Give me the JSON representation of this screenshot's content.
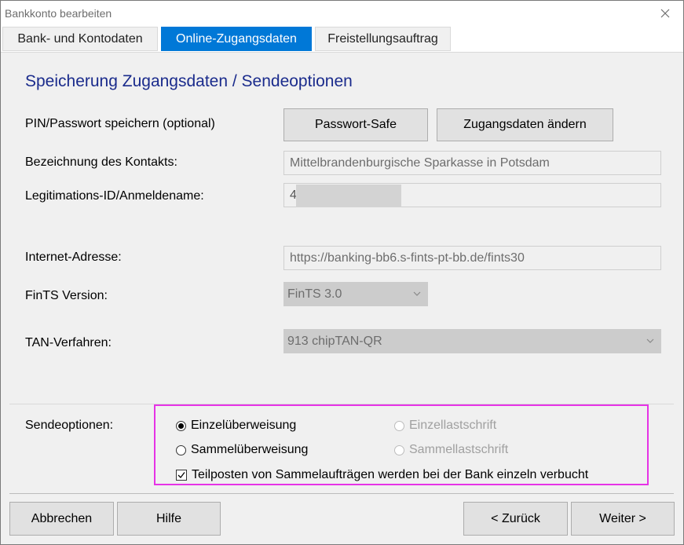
{
  "window": {
    "title": "Bankkonto bearbeiten"
  },
  "tabs": [
    {
      "label": "Bank- und Kontodaten"
    },
    {
      "label": "Online-Zugangsdaten"
    },
    {
      "label": "Freistellungsauftrag"
    }
  ],
  "section": {
    "heading": "Speicherung Zugangsdaten / Sendeoptionen"
  },
  "pin": {
    "label": "PIN/Passwort speichern (optional)",
    "password_safe_button": "Passwort-Safe",
    "change_access_button": "Zugangsdaten ändern"
  },
  "contact": {
    "label": "Bezeichnung des Kontakts:",
    "value": "Mittelbrandenburgische Sparkasse in Potsdam"
  },
  "login": {
    "label": "Legitimations-ID/Anmeldename:",
    "value": "4"
  },
  "internet": {
    "label": "Internet-Adresse:",
    "value": "https://banking-bb6.s-fints-pt-bb.de/fints30"
  },
  "fints": {
    "label": "FinTS Version:",
    "selected": "FinTS 3.0"
  },
  "tan": {
    "label": "TAN-Verfahren:",
    "selected": "913 chipTAN-QR"
  },
  "send_options": {
    "label": "Sendeoptionen:",
    "single_transfer": "Einzelüberweisung",
    "collective_transfer": "Sammelüberweisung",
    "single_debit": "Einzellastschrift",
    "collective_debit": "Sammellastschrift",
    "itemize_checkbox": "Teilposten von Sammelaufträgen werden bei der Bank einzeln verbucht"
  },
  "footer": {
    "cancel": "Abbrechen",
    "help": "Hilfe",
    "back": "< Zurück",
    "next": "Weiter >"
  }
}
